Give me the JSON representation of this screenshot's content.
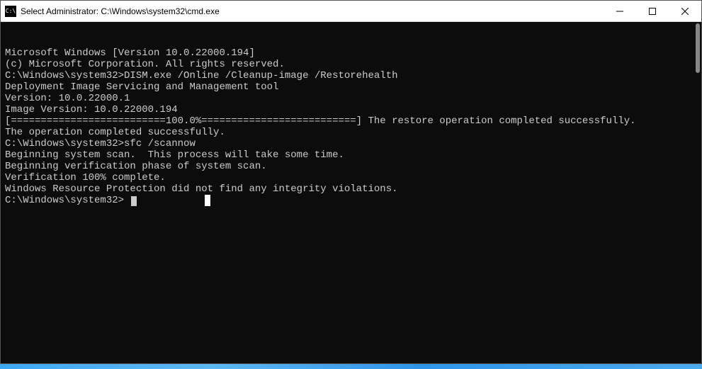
{
  "titlebar": {
    "icon_text": "C:\\",
    "title": "Select Administrator: C:\\Windows\\system32\\cmd.exe"
  },
  "terminal": {
    "lines": [
      "Microsoft Windows [Version 10.0.22000.194]",
      "(c) Microsoft Corporation. All rights reserved.",
      "",
      "C:\\Windows\\system32>DISM.exe /Online /Cleanup-image /Restorehealth",
      "",
      "Deployment Image Servicing and Management tool",
      "Version: 10.0.22000.1",
      "",
      "Image Version: 10.0.22000.194",
      "",
      "[==========================100.0%==========================] The restore operation completed successfully.",
      "The operation completed successfully.",
      "",
      "C:\\Windows\\system32>sfc /scannow",
      "",
      "Beginning system scan.  This process will take some time.",
      "",
      "Beginning verification phase of system scan.",
      "Verification 100% complete.",
      "",
      "Windows Resource Protection did not find any integrity violations.",
      "",
      "C:\\Windows\\system32> "
    ]
  }
}
